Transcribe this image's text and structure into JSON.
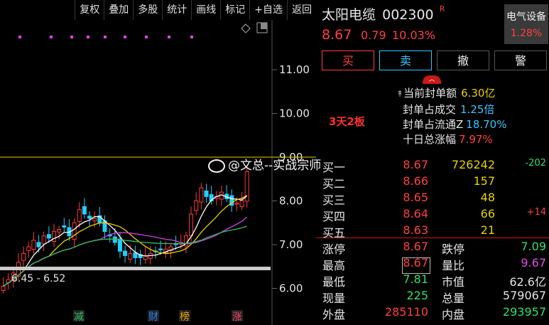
{
  "toolbar": {
    "items": [
      "复权",
      "叠加",
      "多股",
      "统计",
      "画线",
      "标记",
      "+自选",
      "返回"
    ]
  },
  "chart": {
    "y_ticks": [
      "11.00",
      "10.00",
      "9.00",
      "8.00",
      "7.00",
      "6.00"
    ],
    "range_label": "6.45 - 6.52",
    "board_label": "3天2板",
    "events": [
      "减",
      "财",
      "榜",
      "涨"
    ],
    "watermark": "@文总--实战宗师",
    "colors": {
      "up": "#ff3b3b",
      "down": "#22d0ff",
      "ma5": "#ffffff",
      "ma10": "#e8d000",
      "ma20": "#d040e0",
      "ma60": "#30c060"
    }
  },
  "stock": {
    "name": "太阳电缆",
    "code": "002300",
    "flag": "R",
    "price": "8.67",
    "change": "0.79",
    "pct": "10.03%"
  },
  "sector": {
    "name": "电气设备",
    "pct": "1.28%"
  },
  "actions": {
    "buy": "买",
    "sell": "卖",
    "cancel": "撤",
    "alert": "警"
  },
  "seal": {
    "amount_label": "当前封单额",
    "amount": "6.30亿",
    "deal_label": "封单占成交",
    "deal": "1.25倍",
    "float_label": "封单占流通Z",
    "float": "18.70%",
    "tenday_label": "十日总涨幅",
    "tenday": "7.97%"
  },
  "orderbook": [
    {
      "label": "买一",
      "price": "8.67",
      "vol": "726242",
      "delta": "-202"
    },
    {
      "label": "买二",
      "price": "8.66",
      "vol": "157",
      "delta": ""
    },
    {
      "label": "买三",
      "price": "8.65",
      "vol": "48",
      "delta": ""
    },
    {
      "label": "买四",
      "price": "8.64",
      "vol": "66",
      "delta": "+14"
    },
    {
      "label": "买五",
      "price": "8.63",
      "vol": "21",
      "delta": ""
    }
  ],
  "stats": [
    {
      "l1": "涨停",
      "v1": "8.67",
      "l2": "跌停",
      "v2": "7.09"
    },
    {
      "l1": "最高",
      "v1": "8.67",
      "l2": "量比",
      "v2": "9.67"
    },
    {
      "l1": "最低",
      "v1": "7.81",
      "l2": "市值",
      "v2": "62.6亿"
    },
    {
      "l1": "现量",
      "v1": "225",
      "l2": "总量",
      "v2": "579067"
    },
    {
      "l1": "外盘",
      "v1": "285110",
      "l2": "内盘",
      "v2": "293957"
    }
  ]
}
